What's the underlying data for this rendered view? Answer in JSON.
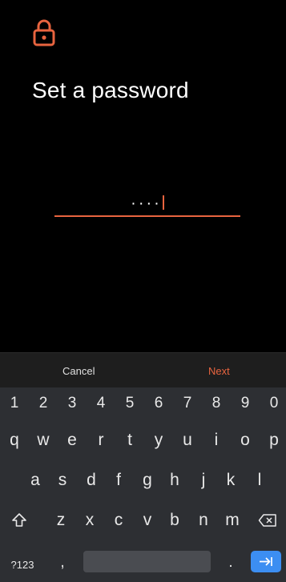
{
  "screen": {
    "title": "Set a password",
    "password_masked": "····",
    "accent_color": "#e8643f"
  },
  "actions": {
    "cancel_label": "Cancel",
    "next_label": "Next"
  },
  "keyboard": {
    "number_row": [
      "1",
      "2",
      "3",
      "4",
      "5",
      "6",
      "7",
      "8",
      "9",
      "0"
    ],
    "row_qwerty": [
      "q",
      "w",
      "e",
      "r",
      "t",
      "y",
      "u",
      "i",
      "o",
      "p"
    ],
    "row_asdf": [
      "a",
      "s",
      "d",
      "f",
      "g",
      "h",
      "j",
      "k",
      "l"
    ],
    "row_zxcv": [
      "z",
      "x",
      "c",
      "v",
      "b",
      "n",
      "m"
    ],
    "symbols_label": "?123",
    "comma_label": ",",
    "period_label": ".",
    "icons": [
      "shift-icon",
      "backspace-icon",
      "enter-icon",
      "lock-icon"
    ]
  }
}
